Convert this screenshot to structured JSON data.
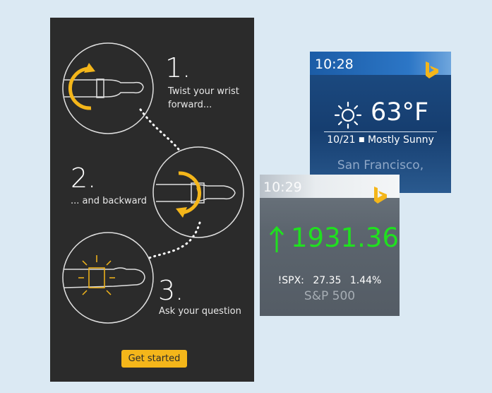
{
  "tutorial": {
    "steps": [
      {
        "number": "1.",
        "text_line1": "Twist your wrist",
        "text_line2": "forward..."
      },
      {
        "number": "2.",
        "text_line1": "... and backward",
        "text_line2": ""
      },
      {
        "number": "3.",
        "text_line1": "Ask your question",
        "text_line2": ""
      }
    ],
    "cta_label": "Get started",
    "accent_color": "#f4b61a"
  },
  "weather_card": {
    "time": "10:28",
    "temperature": "63°F",
    "date": "10/21",
    "condition": "Mostly Sunny",
    "location": "San Francisco, ",
    "icons": [
      "sun-icon",
      "bing-logo-icon"
    ]
  },
  "stock_card": {
    "time": "10:29",
    "value": "1931.36",
    "symbol": "!SPX:",
    "change": "27.35",
    "change_percent": "1.44%",
    "index_name": "S&P 500",
    "up_color": "#20e020",
    "icons": [
      "up-arrow-icon",
      "bing-logo-icon"
    ]
  }
}
